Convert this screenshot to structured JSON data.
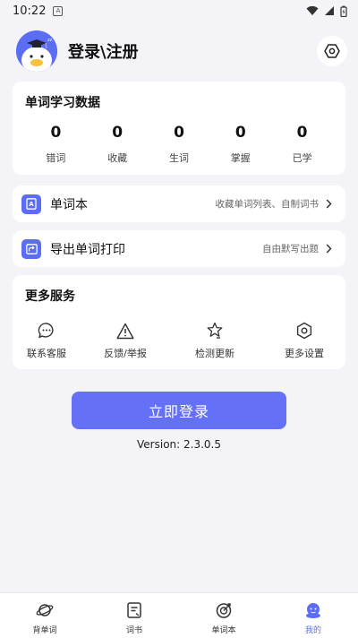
{
  "status_bar": {
    "time": "10:22",
    "notif_glyph": "A"
  },
  "profile": {
    "title": "登录\\注册"
  },
  "stats": {
    "title": "单词学习数据",
    "items": [
      {
        "value": "0",
        "label": "错词"
      },
      {
        "value": "0",
        "label": "收藏"
      },
      {
        "value": "0",
        "label": "生词"
      },
      {
        "value": "0",
        "label": "掌握"
      },
      {
        "value": "0",
        "label": "已学"
      }
    ]
  },
  "wordbook": {
    "title": "单词本",
    "subtitle": "收藏单词列表、自制词书"
  },
  "export": {
    "title": "导出单词打印",
    "subtitle": "自由默写出题"
  },
  "services": {
    "title": "更多服务",
    "items": [
      {
        "label": "联系客服",
        "icon": "chat-icon"
      },
      {
        "label": "反馈/举报",
        "icon": "warning-icon"
      },
      {
        "label": "检测更新",
        "icon": "star-badge-icon"
      },
      {
        "label": "更多设置",
        "icon": "hexagon-settings-icon"
      }
    ]
  },
  "login_button": "立即登录",
  "version": "Version: 2.3.0.5",
  "tabs": [
    {
      "label": "背单词",
      "icon": "planet-icon"
    },
    {
      "label": "词书",
      "icon": "book-icon"
    },
    {
      "label": "单词本",
      "icon": "target-icon"
    },
    {
      "label": "我的",
      "icon": "profile-icon",
      "active": true
    }
  ],
  "colors": {
    "accent": "#5b6cf5",
    "button": "#6470f6",
    "background": "#f4f4f8"
  }
}
